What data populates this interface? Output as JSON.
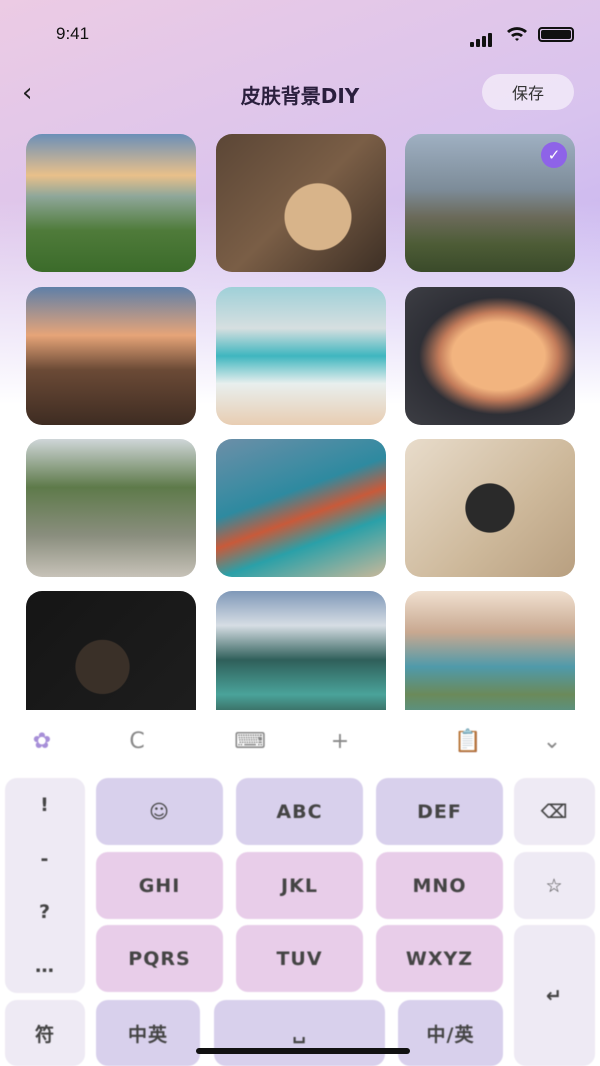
{
  "status_bar": {
    "time": "9:41"
  },
  "header": {
    "title": "皮肤背景DIY",
    "save_label": "保存",
    "back_icon": "chevron-left-icon"
  },
  "backgrounds": [
    {
      "name": "mountain-valley-sunset",
      "selected": false
    },
    {
      "name": "travel-desk-flatlay",
      "selected": false
    },
    {
      "name": "mountain-hiker",
      "selected": true
    },
    {
      "name": "kyoto-pagoda-street",
      "selected": false
    },
    {
      "name": "beach-shore",
      "selected": false
    },
    {
      "name": "airplane-window",
      "selected": false
    },
    {
      "name": "palm-street",
      "selected": false
    },
    {
      "name": "golden-gate-bridge",
      "selected": false
    },
    {
      "name": "vintage-camera-map",
      "selected": false
    },
    {
      "name": "backpack-flatlay",
      "selected": false
    },
    {
      "name": "lake-window-view",
      "selected": false
    },
    {
      "name": "coastal-bay",
      "selected": false
    }
  ],
  "selected_check": "✓",
  "keyboard": {
    "toolbar": [
      "flower-icon",
      "c-icon",
      "keyboard-icon",
      "plus-icon",
      "clipboard-icon",
      "chevron-down-icon"
    ],
    "left_column": [
      "!",
      "-",
      "?",
      "…"
    ],
    "keys": [
      "☺",
      "ABC",
      "DEF",
      "GHI",
      "JKL",
      "MNO",
      "PQRS",
      "TUV",
      "WXYZ"
    ],
    "right_keys": [
      "⌫",
      "☆",
      "↵"
    ],
    "bottom": [
      "符",
      "中英",
      "␣",
      "中/英"
    ]
  },
  "colors": {
    "accent": "#8e63e8",
    "key_row1": "#d8d0ec",
    "key_pink": "#e8cde9"
  }
}
